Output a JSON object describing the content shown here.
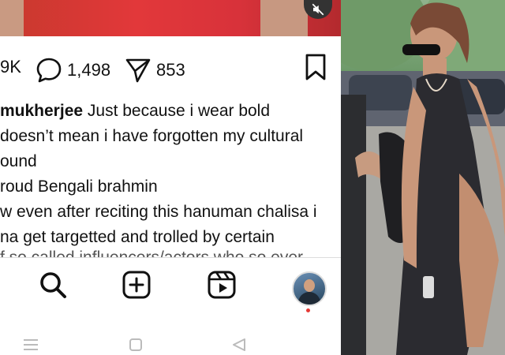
{
  "post": {
    "actions": {
      "likes": "9K",
      "comments": "1,498",
      "shares": "853"
    },
    "caption": {
      "username": "mukherjee",
      "line1_rest": " Just because i wear bold",
      "line2": " doesn’t mean i have forgotten my cultural",
      "line3": "ound",
      "line4": "roud Bengali brahmin",
      "line5": "w even after reciting this hanuman chalisa i",
      "line6": "na get targetted and trolled by certain",
      "line7": "f so called influencers/actors who so ever"
    }
  },
  "bottom_nav": {
    "items": [
      "search",
      "create",
      "reels",
      "profile"
    ]
  },
  "system_nav": {
    "items": [
      "menu",
      "home",
      "back"
    ]
  },
  "colors": {
    "media_red": "#d8323a",
    "text": "#111111",
    "notification_dot": "#e53935"
  },
  "icons": [
    "mute-icon",
    "comment-icon",
    "share-icon",
    "bookmark-icon",
    "search-icon",
    "create-icon",
    "reels-icon"
  ]
}
